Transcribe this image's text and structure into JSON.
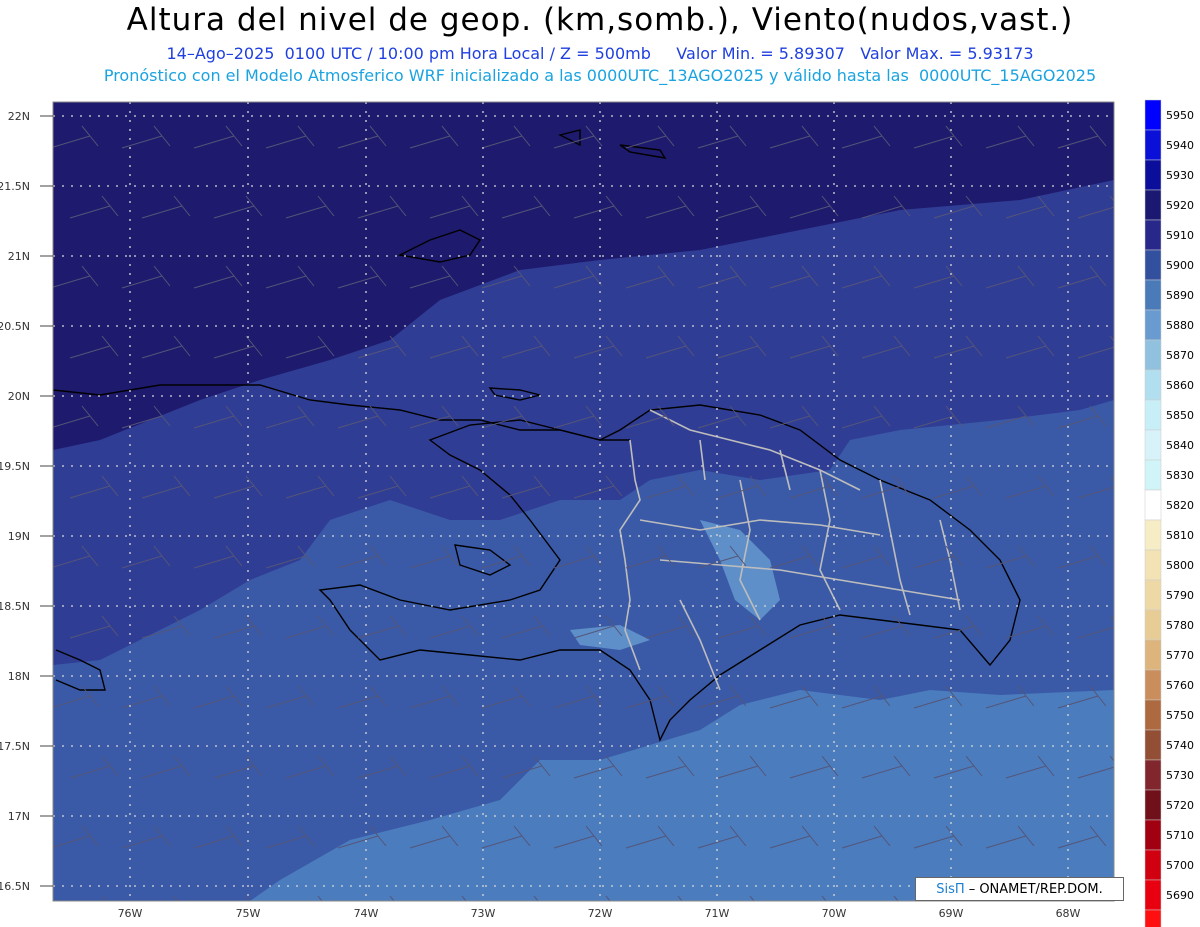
{
  "header": {
    "title": "Altura del nivel de geop. (km,somb.), Viento(nudos,vast.)",
    "subtitle_1": "14–Ago–2025  0100 UTC / 10:00 pm Hora Local / Z = 500mb     Valor Min. = 5.89307   Valor Max. = 5.93173",
    "subtitle_2": "Pronóstico con el Modelo Atmosferico WRF inicializado a las 0000UTC_13AGO2025 y válido hasta las  0000UTC_15AGO2025"
  },
  "axes": {
    "lat_labels": [
      "22N",
      "21.5N",
      "21N",
      "20.5N",
      "20N",
      "19.5N",
      "19N",
      "18.5N",
      "18N",
      "17.5N",
      "17N",
      "16.5N"
    ],
    "lon_labels": [
      "76W",
      "75W",
      "74W",
      "73W",
      "72W",
      "71W",
      "70W",
      "69W",
      "68W"
    ]
  },
  "colorbar": {
    "levels": [
      5950,
      5940,
      5930,
      5920,
      5910,
      5900,
      5890,
      5880,
      5870,
      5860,
      5850,
      5840,
      5830,
      5820,
      5810,
      5800,
      5790,
      5780,
      5770,
      5760,
      5750,
      5740,
      5730,
      5720,
      5710,
      5700,
      5690
    ],
    "colors": [
      "#0000ff",
      "#0a10d8",
      "#0a0e9a",
      "#1a1870",
      "#28278a",
      "#33509e",
      "#4a7ab8",
      "#6a9bd0",
      "#90c2e0",
      "#b2dff0",
      "#c8eef8",
      "#d8f2fa",
      "#d0f4f8",
      "#ffffff",
      "#f6ecc6",
      "#f2e2b4",
      "#eed8a6",
      "#e8cc96",
      "#dcb47c",
      "#c98e5c",
      "#ad6a40",
      "#934e36",
      "#80262c",
      "#70101a",
      "#a00010",
      "#d00010",
      "#e80010",
      "#ff1010"
    ]
  },
  "credit": {
    "brand": "SisΠ",
    "text": "– ONAMET/REP.DOM."
  },
  "colors": {
    "ocean_deep": "#1e1a6e",
    "mid_field": "#2f3d95",
    "lower_field": "#3a5aa8",
    "south_field": "#4b7cbe",
    "light_patch": "#5f8fc8",
    "coast": "#000000",
    "province_border": "#bdbdbd",
    "wind_barb": "#555577"
  }
}
